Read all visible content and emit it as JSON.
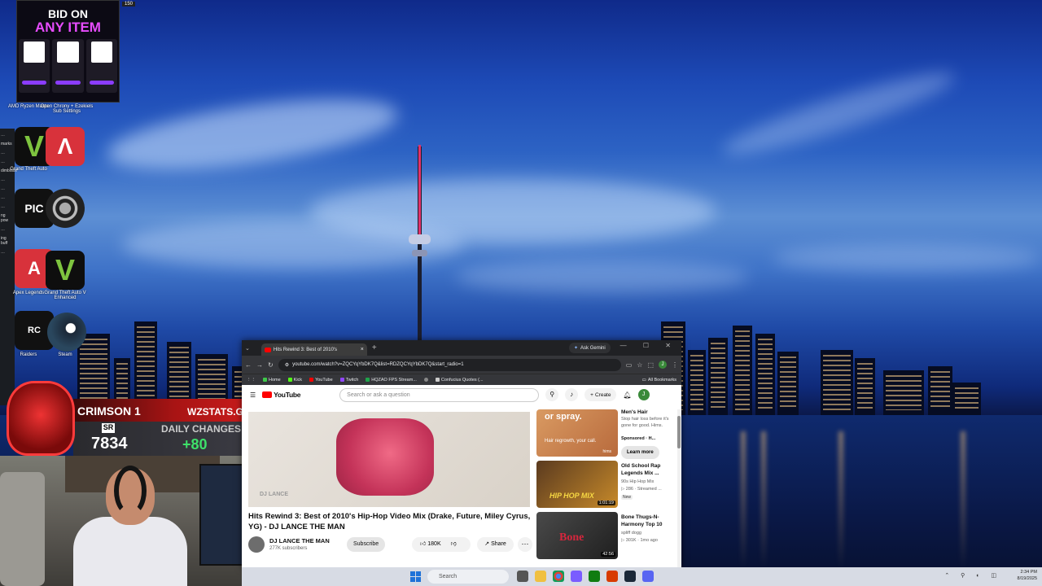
{
  "ad": {
    "line1": "BID ON",
    "line2": "ANY ITEM"
  },
  "top_counter": "150",
  "desktop_icons": [
    {
      "label": "AMD Ryzen Maste",
      "id": "amd"
    },
    {
      "label": "Open Chrony + Ezekiels Sub Settings",
      "id": "chrony"
    },
    {
      "label": "Grand Theft Auto",
      "id": "gta1"
    },
    {
      "label": "Apex Legends",
      "id": "apex"
    },
    {
      "label": "Grand Theft Auto V Enhanced",
      "id": "gta2"
    },
    {
      "label": "Raiders",
      "id": "raiders"
    },
    {
      "label": "Steam",
      "id": "steam"
    }
  ],
  "left_strip": [
    "…",
    "marks",
    "…",
    "…",
    "dimblade",
    "…",
    "…",
    "…",
    "…",
    "ng pow",
    "…",
    "ing buff",
    "…"
  ],
  "overlay": {
    "player_name": "CRIMSON 1",
    "site": "WZSTATS.GG",
    "sr_label": "SR",
    "sr_value": "7834",
    "daily_label": "DAILY CHANGES",
    "daily_value": "+80"
  },
  "browser": {
    "tab_title": "Hits Rewind 3: Best of 2010's",
    "tab_close": "×",
    "new_tab": "+",
    "ask_gemini": "Ask Gemini",
    "window_controls": "— ☐ ✕",
    "url": "youtube.com/watch?v=ZQCYqYbDK7Q&list=RDZQCYqYbDK7Q&start_radio=1",
    "bookmarks": [
      {
        "label": "Home",
        "color": "#3ec94a"
      },
      {
        "label": "Kick",
        "color": "#53fc18"
      },
      {
        "label": "YouTube",
        "color": "#ff0000"
      },
      {
        "label": "Twitch",
        "color": "#9146ff"
      },
      {
        "label": "HQZAO FPS Stream...",
        "color": "#1fa34a"
      },
      {
        "label": "",
        "color": "#888888"
      },
      {
        "label": "Confucius Quotes (...",
        "color": "#cccccc"
      }
    ],
    "all_bookmarks": "All Bookmarks",
    "avatar_letter": "J"
  },
  "youtube": {
    "logo": "YouTube",
    "search_placeholder": "Search or ask a question",
    "create": "Create",
    "avatar_letter": "J",
    "video_watermark": "DJ LANCE",
    "video_title": "Hits Rewind 3: Best of 2010's Hip-Hop Video Mix (Drake, Future, Miley Cyrus, YG) - DJ LANCE THE MAN",
    "channel_name": "DJ LANCE THE MAN",
    "channel_subs": "277K subscribers",
    "subscribe": "Subscribe",
    "likes": "180K",
    "share": "Share",
    "more": "⋯",
    "recs": [
      {
        "title": "Men's Hair",
        "meta1": "Stop hair loss before it's gone for good. Hims.",
        "meta2": "Sponsored · H...",
        "thumb_text": "or spray.",
        "thumb_sub": "Hair regrowth, your call.",
        "thumb_brand": "hims",
        "learn_more": "Learn more"
      },
      {
        "title": "Old School Rap Legends Mix ...",
        "meta1": "90s Hip Hop Mix",
        "meta2": "▷ 286 · Streamed ...",
        "badge": "New",
        "duration": "1:01:19",
        "thumb_text": "HIP HOP MIX"
      },
      {
        "title": "Bone Thugs-N-Harmony Top 10",
        "meta1": "spliff dogg",
        "meta2": "▷ 301K · 1mo ago",
        "duration": "42:56",
        "thumb_text": "Bone"
      }
    ]
  },
  "taskbar": {
    "search": "Search",
    "time": "2:34 PM",
    "date": "8/19/2025"
  }
}
